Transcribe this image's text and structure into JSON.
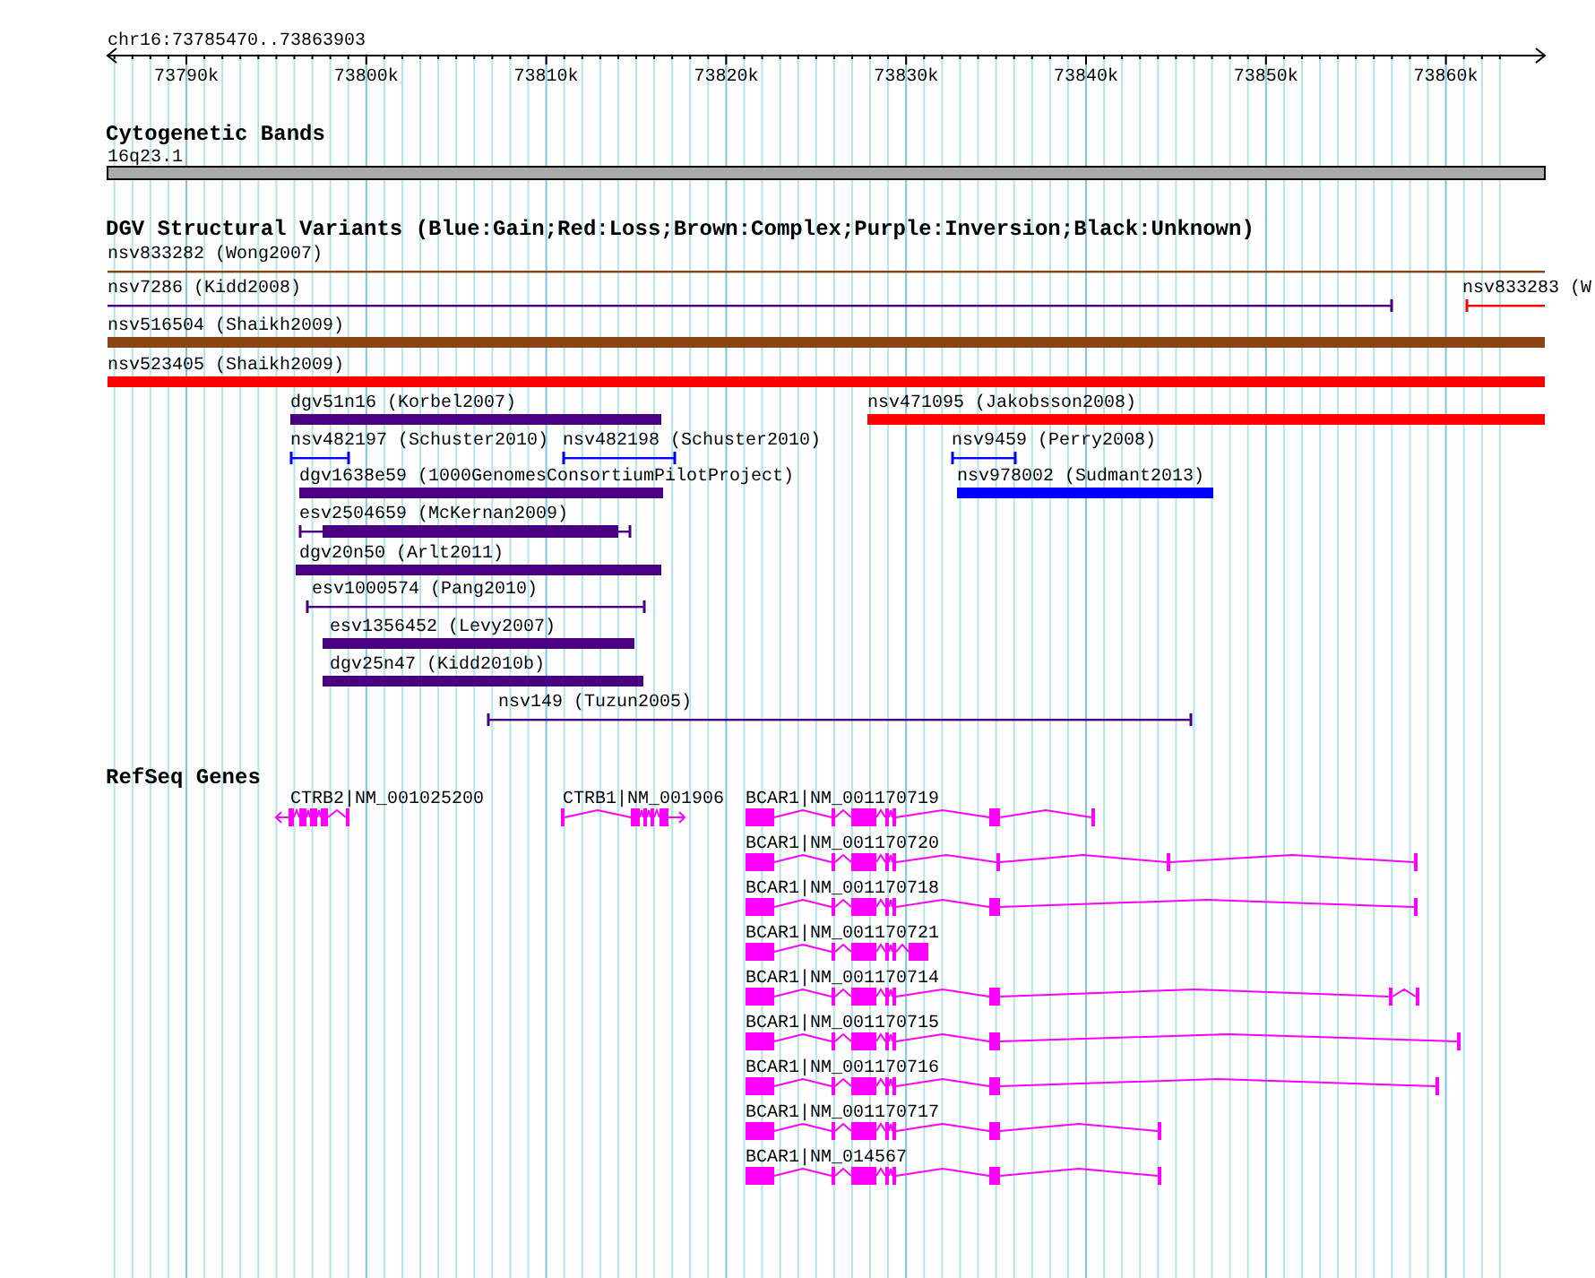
{
  "ruler": {
    "title": "chr16:73785470..73863903",
    "ticks": [
      "73790k",
      "73800k",
      "73810k",
      "73820k",
      "73830k",
      "73840k",
      "73850k",
      "73860k"
    ]
  },
  "tracks": [
    {
      "title": "Cytogenetic Bands",
      "kind": "bands",
      "features": [
        {
          "label": "16q23.1"
        }
      ]
    },
    {
      "title": "DGV Structural Variants (Blue:Gain;Red:Loss;Brown:Complex;Purple:Inversion;Black:Unknown)",
      "kind": "variants",
      "features": [
        {
          "label": "nsv833282 (Wong2007)",
          "kind": "line",
          "color": "#8b4513"
        },
        {
          "label": "nsv7286 (Kidd2008)",
          "kind": "line",
          "color": "#4b0082"
        },
        {
          "label": "nsv833283 (W",
          "kind": "line",
          "color": "#ff0000"
        },
        {
          "label": "nsv516504 (Shaikh2009)",
          "kind": "bar",
          "color": "#8b4513"
        },
        {
          "label": "nsv523405 (Shaikh2009)",
          "kind": "bar",
          "color": "#ff0000"
        },
        {
          "label": "dgv51n16 (Korbel2007)",
          "kind": "bar",
          "color": "#4b0082"
        },
        {
          "label": "nsv471095 (Jakobsson2008)",
          "kind": "bar",
          "color": "#ff0000"
        },
        {
          "label": "nsv482197 (Schuster2010)",
          "kind": "line",
          "color": "#0000ff"
        },
        {
          "label": "nsv482198 (Schuster2010)",
          "kind": "line",
          "color": "#0000ff"
        },
        {
          "label": "nsv9459 (Perry2008)",
          "kind": "line",
          "color": "#0000ff"
        },
        {
          "label": "dgv1638e59 (1000GenomesConsortiumPilotProject)",
          "kind": "bar",
          "color": "#4b0082"
        },
        {
          "label": "nsv978002 (Sudmant2013)",
          "kind": "bar",
          "color": "#0000ff"
        },
        {
          "label": "esv2504659 (McKernan2009)",
          "kind": "mixed",
          "color": "#4b0082"
        },
        {
          "label": "dgv20n50 (Arlt2011)",
          "kind": "bar",
          "color": "#4b0082"
        },
        {
          "label": "esv1000574 (Pang2010)",
          "kind": "line",
          "color": "#4b0082"
        },
        {
          "label": "esv1356452 (Levy2007)",
          "kind": "bar",
          "color": "#4b0082"
        },
        {
          "label": "dgv25n47 (Kidd2010b)",
          "kind": "bar",
          "color": "#4b0082"
        },
        {
          "label": "nsv149 (Tuzun2005)",
          "kind": "line",
          "color": "#4b0082"
        }
      ]
    },
    {
      "title": "RefSeq Genes",
      "kind": "genes",
      "features": [
        {
          "label": "CTRB2|NM_001025200"
        },
        {
          "label": "CTRB1|NM_001906"
        },
        {
          "label": "BCAR1|NM_001170719"
        },
        {
          "label": "BCAR1|NM_001170720"
        },
        {
          "label": "BCAR1|NM_001170718"
        },
        {
          "label": "BCAR1|NM_001170721"
        },
        {
          "label": "BCAR1|NM_001170714"
        },
        {
          "label": "BCAR1|NM_001170715"
        },
        {
          "label": "BCAR1|NM_001170716"
        },
        {
          "label": "BCAR1|NM_001170717"
        },
        {
          "label": "BCAR1|NM_014567"
        }
      ]
    }
  ]
}
